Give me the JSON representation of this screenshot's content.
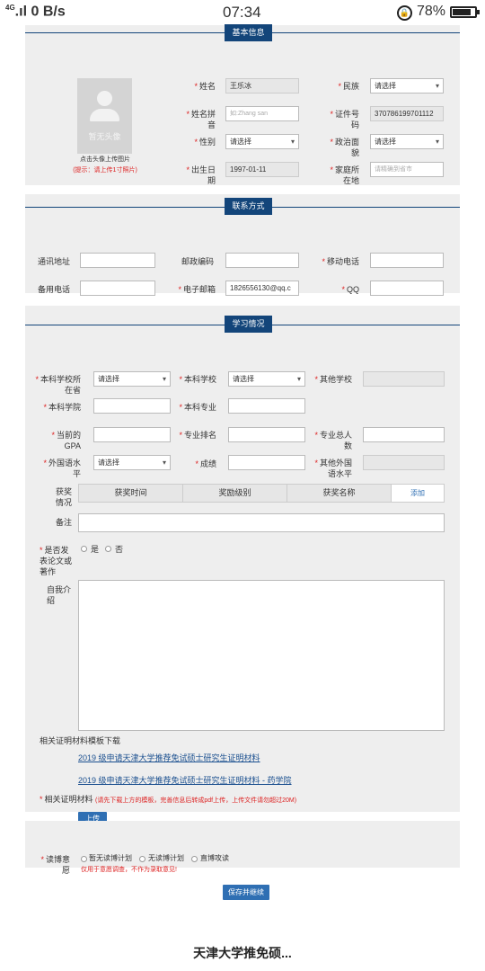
{
  "status_bar": {
    "signal": "4G",
    "speed": "0 B/s",
    "time": "07:34",
    "battery": "78%"
  },
  "section_basic": {
    "title": "基本信息",
    "avatar_text": "暂无头像",
    "avatar_caption": "点击头像上传图片",
    "avatar_hint": "(提示：请上传1寸照片)",
    "name_label": "姓名",
    "name_value": "王乐冰",
    "ethnic_label": "民族",
    "ethnic_value": "请选择",
    "pinyin_label": "姓名拼音",
    "pinyin_placeholder": "如:Zhang san",
    "id_label": "证件号码",
    "id_value": "370786199701112",
    "gender_label": "性别",
    "gender_value": "请选择",
    "political_label": "政治面貌",
    "political_value": "请选择",
    "birth_label": "出生日期",
    "birth_value": "1997-01-11",
    "home_label": "家庭所在地",
    "home_placeholder": "请精确到省市"
  },
  "section_contact": {
    "title": "联系方式",
    "address_label": "通讯地址",
    "postcode_label": "邮政编码",
    "mobile_label": "移动电话",
    "backup_phone_label": "备用电话",
    "email_label": "电子邮箱",
    "email_value": "1826556130@qq.c",
    "qq_label": "QQ"
  },
  "section_study": {
    "title": "学习情况",
    "school_province_label": "本科学校所在省",
    "school_province_value": "请选择",
    "school_label": "本科学校",
    "school_value": "请选择",
    "other_school_label": "其他学校",
    "college_label": "本科学院",
    "major_label": "本科专业",
    "gpa_label": "当前的GPA",
    "rank_label": "专业排名",
    "total_label": "专业总人数",
    "lang_label": "外国语水平",
    "lang_value": "请选择",
    "score_label": "成绩",
    "other_lang_label": "其他外国语水平",
    "award_label": "获奖情况",
    "award_cols": [
      "获奖时间",
      "奖励级别",
      "获奖名称"
    ],
    "award_add": "添加",
    "remark_label": "备注",
    "paper_label": "是否发表论文或著作",
    "paper_yes": "是",
    "paper_no": "否",
    "intro_label": "自我介绍",
    "template_title": "相关证明材料模板下载",
    "template_link1": "2019 级申请天津大学推荐免试硕士研究生证明材料",
    "template_link2": "2019 级申请天津大学推荐免试硕士研究生证明材料 - 药学院",
    "proof_label": "相关证明材料",
    "proof_hint": "(请先下载上方的模板，完善信息后转成pdf上传，上传文件请勿超过20M)",
    "upload_button": "上传"
  },
  "section_intent": {
    "label": "读博意愿",
    "options": [
      "暂无读博计划",
      "无读博计划",
      "直博攻读"
    ],
    "note": "仅用于意愿调查，不作为录取意见!",
    "save_button": "保存并继续"
  },
  "caption": "天津大学推免硕..."
}
